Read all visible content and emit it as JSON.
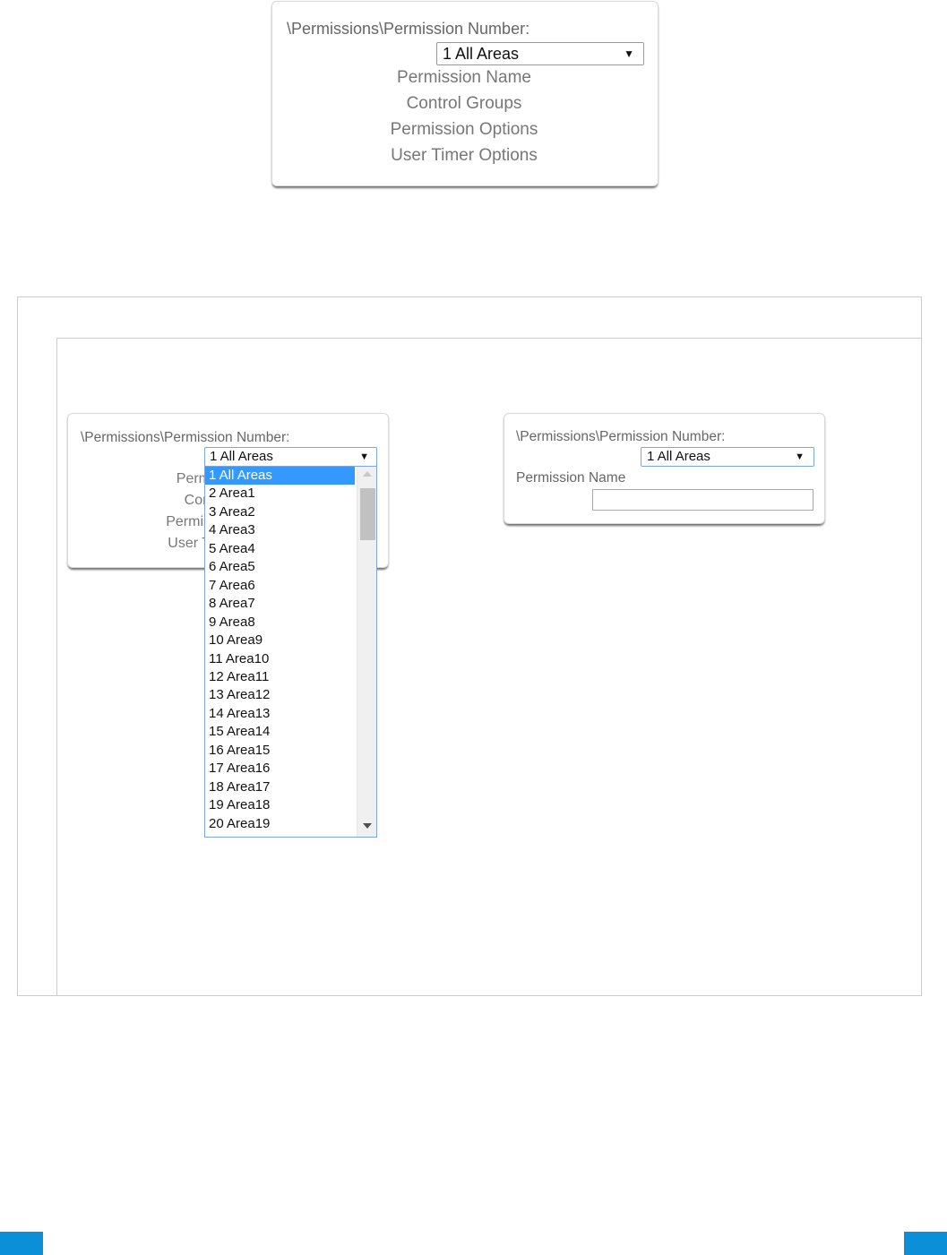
{
  "top_card": {
    "path_label": "\\Permissions\\Permission Number:",
    "select_value": "1 All Areas",
    "menu_items": [
      "Permission Name",
      "Control Groups",
      "Permission Options",
      "User Timer Options"
    ]
  },
  "left_card": {
    "path_label": "\\Permissions\\Permission Number:",
    "select_value": "1 All Areas",
    "menu_items_partial": [
      "Perm",
      "Con",
      "Permis",
      "User T"
    ],
    "dropdown_options": [
      "1 All Areas",
      "2 Area1",
      "3 Area2",
      "4 Area3",
      "5 Area4",
      "6 Area5",
      "7 Area6",
      "8 Area7",
      "9 Area8",
      "10 Area9",
      "11 Area10",
      "12 Area11",
      "13 Area12",
      "14 Area13",
      "15 Area14",
      "16 Area15",
      "17 Area16",
      "18 Area17",
      "19 Area18",
      "20 Area19"
    ],
    "selected_index": 0
  },
  "right_card": {
    "path_label": "\\Permissions\\Permission Number:",
    "select_value": "1 All Areas",
    "name_label": "Permission Name",
    "name_value": ""
  },
  "icons": {
    "select_arrow": "▼",
    "scroll_up": "scroll-up-arrow-icon",
    "scroll_down": "scroll-down-arrow-icon"
  },
  "colors": {
    "selected_option_bg": "#3399ff",
    "focus_border": "#7aa7dd",
    "footer_accent": "#0a8fd8"
  }
}
